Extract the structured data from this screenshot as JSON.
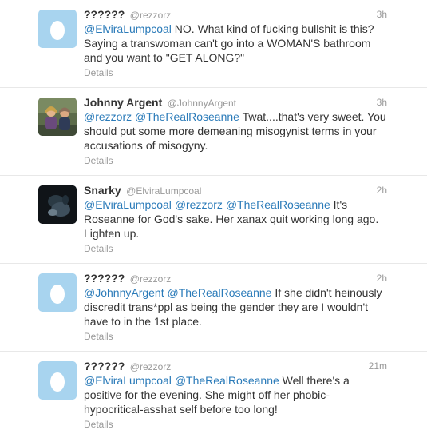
{
  "tweets": [
    {
      "fullname": "??????",
      "username": "@rezzorz",
      "time": "3h",
      "avatar": "egg-avatar",
      "mentions": [
        "@ElviraLumpcoal"
      ],
      "text": " NO. What kind of fucking bullshit is this? Saying a transwoman can't go into a WOMAN'S bathroom and you want to \"GET ALONG?\"",
      "details_label": "Details"
    },
    {
      "fullname": "Johnny Argent",
      "username": "@JohnnyArgent",
      "time": "3h",
      "avatar": "photo-avatar",
      "mentions": [
        "@rezzorz",
        "@TheRealRoseanne"
      ],
      "text": " Twat....that's very sweet. You should put some more demeaning misogynist terms in your accusations of misogyny.",
      "details_label": "Details"
    },
    {
      "fullname": "Snarky",
      "username": "@ElviraLumpcoal",
      "time": "2h",
      "avatar": "dark-photo-avatar",
      "mentions": [
        "@ElviraLumpcoal",
        "@rezzorz",
        "@TheRealRoseanne"
      ],
      "text": " It's Roseanne for God's sake. Her xanax quit working long ago. Lighten up.",
      "details_label": "Details"
    },
    {
      "fullname": "??????",
      "username": "@rezzorz",
      "time": "2h",
      "avatar": "egg-avatar",
      "mentions": [
        "@JohnnyArgent",
        "@TheRealRoseanne"
      ],
      "text": " If she didn't heinously discredit trans*ppl as being the gender they are I wouldn't have to in the 1st place.",
      "details_label": "Details"
    },
    {
      "fullname": "??????",
      "username": "@rezzorz",
      "time": "21m",
      "avatar": "egg-avatar",
      "mentions": [
        "@ElviraLumpcoal",
        "@TheRealRoseanne"
      ],
      "text": " Well there's a positive for the evening. She might off her phobic-hypocritical-asshat self before too long!",
      "details_label": "Details"
    }
  ],
  "colors": {
    "link": "#2b7bb9",
    "muted": "#999999",
    "text": "#333333",
    "egg_bg": "#a8d4ef"
  }
}
